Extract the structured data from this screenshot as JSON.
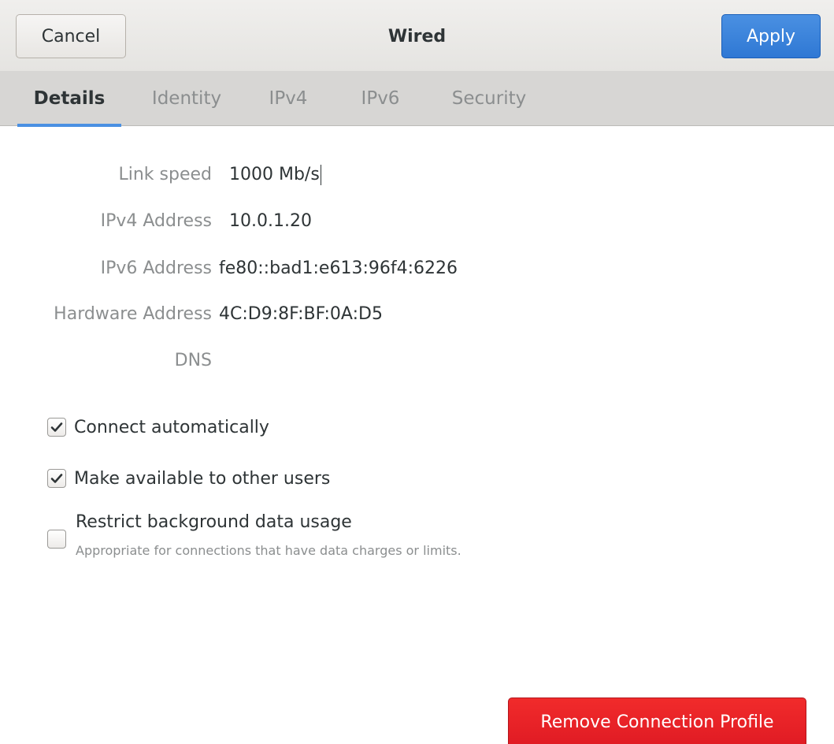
{
  "header": {
    "title": "Wired",
    "cancel_label": "Cancel",
    "apply_label": "Apply"
  },
  "tabs": [
    {
      "label": "Details",
      "active": true
    },
    {
      "label": "Identity",
      "active": false
    },
    {
      "label": "IPv4",
      "active": false
    },
    {
      "label": "IPv6",
      "active": false
    },
    {
      "label": "Security",
      "active": false
    }
  ],
  "details": {
    "link_speed": {
      "label": "Link speed",
      "value": "1000 Mb/s"
    },
    "ipv4": {
      "label": "IPv4 Address",
      "value": "10.0.1.20"
    },
    "ipv6": {
      "label": "IPv6 Address",
      "value": "fe80::bad1:e613:96f4:6226"
    },
    "hardware": {
      "label": "Hardware Address",
      "value": "4C:D9:8F:BF:0A:D5"
    },
    "dns": {
      "label": "DNS",
      "value": ""
    }
  },
  "options": {
    "connect_auto": {
      "label": "Connect automatically",
      "checked": true
    },
    "available_users": {
      "label": "Make available to other users",
      "checked": true
    },
    "restrict_bg": {
      "label": "Restrict background data usage",
      "sublabel": "Appropriate for connections that have data charges or limits.",
      "checked": false
    }
  },
  "remove_label": "Remove Connection Profile",
  "colors": {
    "accent": "#4a90e2",
    "destructive": "#e01b24",
    "dim_text": "#8b8e8f"
  }
}
